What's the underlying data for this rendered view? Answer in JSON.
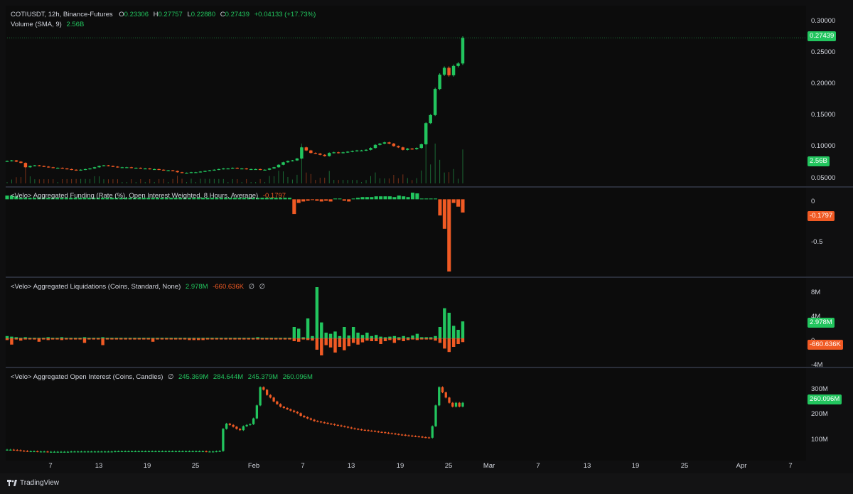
{
  "app": {
    "brand": "TradingView"
  },
  "colors": {
    "up": "#22c55e",
    "down": "#f05a24",
    "text": "#d1d4dc",
    "background": "#0c0c0c"
  },
  "panes": {
    "price": {
      "legend": {
        "symbol": "COTIUSDT, 12h, Binance-Futures",
        "o_label": "O",
        "o": "0.23306",
        "h_label": "H",
        "h": "0.27757",
        "l_label": "L",
        "l": "0.22880",
        "c_label": "C",
        "c": "0.27439",
        "change": "+0.04133 (+17.73%)",
        "volume_label": "Volume (SMA, 9)",
        "volume_value": "2.56B"
      },
      "ticks": [
        "0.30000",
        "0.25000",
        "0.20000",
        "0.15000",
        "0.10000",
        "0.05000"
      ],
      "last_price": "0.27439",
      "last_volume": "2.56B"
    },
    "funding": {
      "legend": {
        "title": "<Velo> Aggregated Funding (Rate (%), Open Interest Weighted, 8 Hours, Average)",
        "value": "-0.1797"
      },
      "ticks": [
        "0",
        "-0.5"
      ],
      "last_value": "-0.1797"
    },
    "liquidations": {
      "legend": {
        "title": "<Velo> Aggregated Liquidations (Coins, Standard, None)",
        "v1": "2.978M",
        "v2": "-660.636K",
        "v3": "∅",
        "v4": "∅"
      },
      "ticks": [
        "8M",
        "4M",
        "0",
        "-4M"
      ],
      "last_long": "2.978M",
      "last_short": "-660.636K"
    },
    "open_interest": {
      "legend": {
        "title": "<Velo> Aggregated Open Interest (Coins, Candles)",
        "o_sym": "∅",
        "v1": "245.369M",
        "v2": "284.644M",
        "v3": "245.379M",
        "v4": "260.096M"
      },
      "ticks": [
        "300M",
        "200M",
        "100M"
      ],
      "last_value": "260.096M"
    }
  },
  "time_axis": [
    "7",
    "13",
    "19",
    "25",
    "Feb",
    "7",
    "13",
    "19",
    "25",
    "Mar",
    "7",
    "13",
    "19",
    "25",
    "Apr",
    "7"
  ],
  "chart_data": [
    {
      "type": "candlestick",
      "title": "COTIUSDT, 12h, Binance-Futures",
      "ylim": [
        0.04,
        0.31
      ],
      "open_last": 0.23306,
      "high_last": 0.27757,
      "low_last": 0.2288,
      "close_last": 0.27439,
      "close": [
        0.076,
        0.077,
        0.075,
        0.073,
        0.066,
        0.068,
        0.069,
        0.068,
        0.067,
        0.066,
        0.065,
        0.065,
        0.064,
        0.063,
        0.062,
        0.061,
        0.062,
        0.063,
        0.064,
        0.066,
        0.068,
        0.069,
        0.068,
        0.067,
        0.066,
        0.066,
        0.066,
        0.065,
        0.065,
        0.064,
        0.064,
        0.063,
        0.063,
        0.062,
        0.061,
        0.061,
        0.06,
        0.058,
        0.057,
        0.057,
        0.058,
        0.058,
        0.059,
        0.06,
        0.061,
        0.062,
        0.063,
        0.064,
        0.064,
        0.065,
        0.064,
        0.064,
        0.063,
        0.063,
        0.063,
        0.062,
        0.062,
        0.064,
        0.066,
        0.07,
        0.074,
        0.076,
        0.077,
        0.08,
        0.098,
        0.093,
        0.089,
        0.088,
        0.086,
        0.084,
        0.089,
        0.09,
        0.089,
        0.09,
        0.091,
        0.092,
        0.093,
        0.093,
        0.094,
        0.097,
        0.102,
        0.104,
        0.106,
        0.104,
        0.1,
        0.098,
        0.094,
        0.096,
        0.095,
        0.097,
        0.103,
        0.137,
        0.15,
        0.192,
        0.215,
        0.226,
        0.214,
        0.229,
        0.233,
        0.274
      ],
      "volume_last": "2.56B"
    },
    {
      "type": "bar",
      "title": "<Velo> Aggregated Funding (Rate (%), Open Interest Weighted, 8 Hours, Average)",
      "ylim": [
        -1.0,
        0.1
      ],
      "values": [
        0.05,
        0.05,
        0.04,
        0.02,
        0.02,
        0.02,
        0.02,
        0.02,
        0.02,
        0.02,
        0.02,
        0.02,
        0.02,
        0.02,
        0.02,
        0.02,
        0.02,
        0.02,
        0.02,
        0.02,
        0.02,
        0.02,
        0.02,
        0.02,
        0.02,
        0.02,
        0.02,
        0.02,
        0.02,
        0.02,
        0.02,
        0.02,
        0.02,
        0.02,
        0.02,
        0.02,
        0.02,
        0.02,
        0.02,
        0.02,
        0.02,
        0.02,
        0.02,
        0.02,
        0.02,
        0.02,
        0.02,
        0.02,
        0.02,
        0.02,
        0.02,
        0.02,
        0.02,
        0.02,
        0.02,
        0.02,
        0.02,
        0.02,
        0.02,
        0.02,
        0.02,
        0.02,
        0.02,
        -0.2,
        -0.05,
        -0.03,
        -0.02,
        -0.01,
        -0.02,
        -0.03,
        -0.02,
        -0.03,
        0.01,
        0.01,
        -0.02,
        -0.03,
        0.01,
        0.02,
        0.03,
        0.03,
        0.03,
        0.04,
        0.04,
        0.04,
        0.04,
        0.03,
        0.05,
        0.04,
        0.03,
        0.09,
        0.08,
        0.01,
        0.01,
        0.01,
        0.01,
        -0.22,
        -0.4,
        -0.98,
        -0.05,
        -0.1,
        -0.18
      ]
    },
    {
      "type": "bar",
      "title": "<Velo> Aggregated Liquidations (Coins, Standard, None)",
      "ylim": [
        -4.5,
        9.5
      ],
      "series": [
        {
          "name": "2.978M",
          "values": [
            0.4,
            0.3,
            0.2,
            0.1,
            0.2,
            0.1,
            0.1,
            0.1,
            0.1,
            0.2,
            0.1,
            0.1,
            0.2,
            0.1,
            0.1,
            0.1,
            0.1,
            0.2,
            0.1,
            0.1,
            0.1,
            0.2,
            0.1,
            0.1,
            0.1,
            0.1,
            0.1,
            0.1,
            0.1,
            0.1,
            0.1,
            0.1,
            0.1,
            0.1,
            0.1,
            0.1,
            0.1,
            0.1,
            0.1,
            0.1,
            0.1,
            0.1,
            0.1,
            0.1,
            0.1,
            0.1,
            0.1,
            0.1,
            0.1,
            0.1,
            0.1,
            0.1,
            0.1,
            0.1,
            0.1,
            0.2,
            0.1,
            0.1,
            0.1,
            0.1,
            0.1,
            0.1,
            0.1,
            2.0,
            1.7,
            0.2,
            3.5,
            0.4,
            9.0,
            2.8,
            1.0,
            0.8,
            1.2,
            0.4,
            2.0,
            0.5,
            2.0,
            1.0,
            0.6,
            1.0,
            0.4,
            0.6,
            0.3,
            0.2,
            0.3,
            0.4,
            0.2,
            0.4,
            0.2,
            0.5,
            0.8,
            0.2,
            0.2,
            0.2,
            0.4,
            2.0,
            5.3,
            4.5,
            2.2,
            1.5,
            2.978
          ]
        },
        {
          "name": "-660.636K",
          "values": [
            -0.3,
            -1.1,
            -0.2,
            -0.4,
            -0.2,
            -0.2,
            -0.2,
            -0.6,
            -0.2,
            -0.3,
            -0.2,
            -0.2,
            -0.3,
            -0.2,
            -0.2,
            -0.2,
            -0.2,
            -0.8,
            -0.2,
            -0.2,
            -0.2,
            -1.2,
            -0.2,
            -0.2,
            -0.2,
            -0.2,
            -0.2,
            -0.2,
            -0.2,
            -0.2,
            -0.2,
            -0.2,
            -0.6,
            -0.2,
            -0.2,
            -0.2,
            -0.2,
            -0.2,
            -0.2,
            -0.2,
            -0.3,
            -0.3,
            -0.3,
            -0.3,
            -0.2,
            -0.2,
            -0.2,
            -0.2,
            -0.2,
            -0.2,
            -0.2,
            -0.2,
            -0.2,
            -0.2,
            -0.2,
            -0.2,
            -0.2,
            -0.2,
            -0.2,
            -0.2,
            -0.2,
            -0.2,
            -0.2,
            -0.5,
            -0.6,
            -0.2,
            -0.3,
            -0.4,
            -2.0,
            -3.0,
            -1.2,
            -1.6,
            -2.5,
            -1.5,
            -2.1,
            -1.4,
            -0.8,
            -1.1,
            -0.7,
            -0.4,
            -0.5,
            -0.5,
            -1.0,
            -0.5,
            -0.3,
            -0.8,
            -0.3,
            -0.5,
            -0.3,
            -0.2,
            -0.3,
            -0.2,
            -0.2,
            -0.2,
            -0.4,
            -0.8,
            -1.8,
            -2.4,
            -1.5,
            -1.0,
            -0.66
          ]
        }
      ]
    },
    {
      "type": "candlestick",
      "title": "<Velo> Aggregated Open Interest (Coins, Candles)",
      "ylim": [
        60,
        360
      ],
      "open_last": 245.369,
      "high_last": 284.644,
      "low_last": 245.379,
      "close_last": 260.096,
      "close": [
        80,
        80,
        79,
        78,
        76,
        75,
        74,
        74,
        74,
        73,
        73,
        73,
        72,
        72,
        72,
        72,
        72,
        72,
        72,
        73,
        73,
        73,
        73,
        73,
        73,
        73,
        73,
        73,
        73,
        73,
        73,
        73,
        74,
        74,
        74,
        74,
        74,
        74,
        74,
        74,
        74,
        74,
        74,
        74,
        74,
        74,
        74,
        74,
        74,
        74,
        74,
        74,
        74,
        74,
        74,
        74,
        74,
        74,
        74,
        73,
        73,
        73,
        74,
        75,
        160,
        180,
        175,
        168,
        160,
        155,
        170,
        175,
        178,
        200,
        250,
        320,
        310,
        290,
        280,
        265,
        255,
        245,
        240,
        235,
        230,
        225,
        220,
        210,
        205,
        200,
        195,
        190,
        188,
        185,
        183,
        180,
        178,
        175,
        173,
        170,
        168,
        165,
        162,
        160,
        158,
        156,
        155,
        153,
        152,
        150,
        148,
        147,
        145,
        143,
        142,
        140,
        138,
        137,
        135,
        134,
        132,
        131,
        130,
        128,
        127,
        126,
        170,
        250,
        320,
        300,
        280,
        260,
        245,
        260,
        245.379,
        260.096
      ]
    }
  ]
}
